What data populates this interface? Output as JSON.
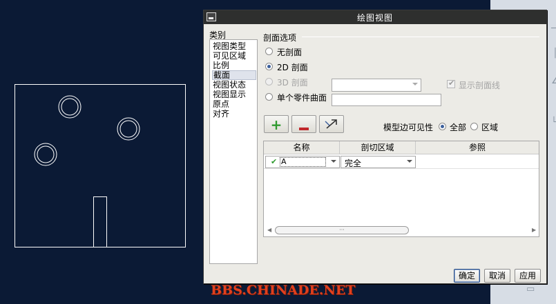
{
  "dialog": {
    "title": "绘图视图",
    "categories_label": "类别",
    "categories": [
      "视图类型",
      "可见区域",
      "比例",
      "截面",
      "视图状态",
      "视图显示",
      "原点",
      "对齐"
    ],
    "selected_category": "截面",
    "section_options": {
      "header": "剖面选项",
      "no_section": "无剖面",
      "section_2d": "2D 剖面",
      "section_3d": "3D 剖面",
      "single_part_surface": "单个零件曲面",
      "selected_option": "2D 剖面",
      "section_3d_combo_value": "",
      "surface_field_value": "",
      "show_section_lines_label": "显示剖面线",
      "show_section_lines_checked": true
    },
    "model_edge_visibility": {
      "label": "模型边可见性",
      "all": "全部",
      "region": "区域",
      "selected": "全部"
    },
    "table": {
      "columns": [
        "名称",
        "剖切区域",
        "参照"
      ],
      "rows": [
        {
          "name": "A",
          "cut_region": "完全",
          "reference": ""
        }
      ],
      "scroll_grip": "···"
    },
    "buttons": {
      "ok": "确定",
      "cancel": "取消",
      "apply": "应用"
    }
  },
  "watermark": "BBS.CHINADE.NET",
  "colors": {
    "canvas_bg": "#0b1a35",
    "drawing_line": "#ffffff",
    "dialog_bg": "#ecebe6",
    "titlebar_bg": "#2e2f2e",
    "add_green": "#2f9a2f",
    "remove_red": "#c0282b",
    "watermark_red": "#e0401e"
  }
}
